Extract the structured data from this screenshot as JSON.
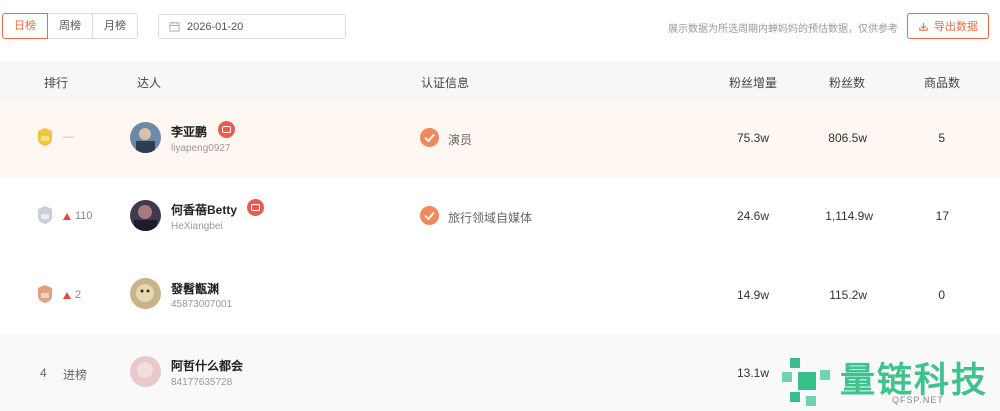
{
  "toolbar": {
    "tabs": [
      {
        "label": "日榜",
        "active": true
      },
      {
        "label": "周榜",
        "active": false
      },
      {
        "label": "月榜",
        "active": false
      }
    ],
    "date_value": "2026-01-20",
    "note": "展示数据为所选周期内蝉妈妈的预估数据，仅供参考",
    "export_label": "导出数据",
    "accent_color": "#ee6b4a"
  },
  "table": {
    "headers": {
      "rank": "排行",
      "creator": "达人",
      "cert": "认证信息",
      "fan_growth": "粉丝增量",
      "fans": "粉丝数",
      "products": "商品数"
    },
    "rows": [
      {
        "rank": "1",
        "trend": "—",
        "trend_dir": "flat",
        "name": "李亚鹏",
        "uid": "liyapeng0927",
        "live": true,
        "cert": "演员",
        "fan_growth": "75.3w",
        "fans": "806.5w",
        "products": "5",
        "badge": "gold"
      },
      {
        "rank": "2",
        "trend": "110",
        "trend_dir": "up",
        "name": "何香蓓Betty",
        "uid": "HeXiangbei",
        "live": true,
        "cert": "旅行领域自媒体",
        "fan_growth": "24.6w",
        "fans": "1,114.9w",
        "products": "17",
        "badge": "silver"
      },
      {
        "rank": "3",
        "trend": "2",
        "trend_dir": "up",
        "name": "發髫甑渊",
        "uid": "45873007001",
        "live": false,
        "cert": "",
        "fan_growth": "14.9w",
        "fans": "115.2w",
        "products": "0",
        "badge": "bronze"
      },
      {
        "rank": "4",
        "trend": "进榜",
        "trend_dir": "new",
        "name": "阿哲什么都会",
        "uid": "84177635728",
        "live": false,
        "cert": "",
        "fan_growth": "13.1w",
        "fans": "",
        "products": "",
        "badge": "none"
      }
    ]
  },
  "watermark": {
    "text": "量链科技",
    "sub": "QFSP.NET"
  }
}
